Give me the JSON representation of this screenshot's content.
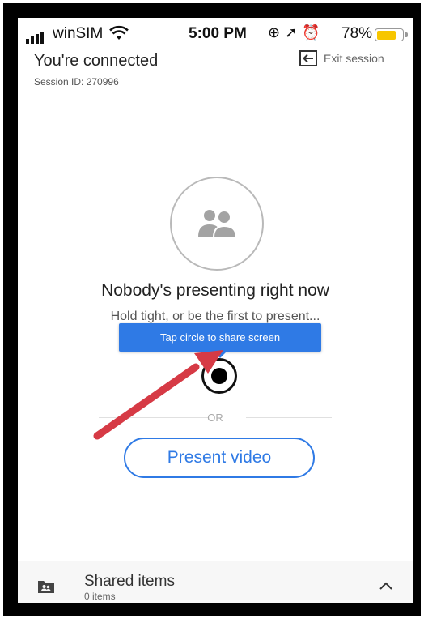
{
  "status_bar": {
    "carrier": "winSIM",
    "time": "5:00 PM",
    "battery_percent_label": "78%",
    "battery_level": 0.78,
    "icons": [
      "signal-icon",
      "wifi-icon",
      "lock-rotation-icon",
      "location-icon",
      "alarm-icon",
      "battery-icon"
    ]
  },
  "header": {
    "title": "You're connected",
    "session_id": "Session ID: 270996",
    "exit_label": "Exit session",
    "exit_icon": "exit-icon"
  },
  "main": {
    "avatar_icon": "people-icon",
    "headline": "Nobody's presenting right now",
    "subline": "Hold tight, or be the first to present...",
    "tooltip": "Tap circle to share screen",
    "or_label": "OR",
    "present_video_label": "Present video"
  },
  "bottom": {
    "icon": "shared-folder-icon",
    "title": "Shared items",
    "count": "0 items",
    "expand_icon": "chevron-up-icon"
  },
  "colors": {
    "accent": "#2f7ae5",
    "annotation_arrow": "#d63a45",
    "battery": "#f7c600"
  }
}
